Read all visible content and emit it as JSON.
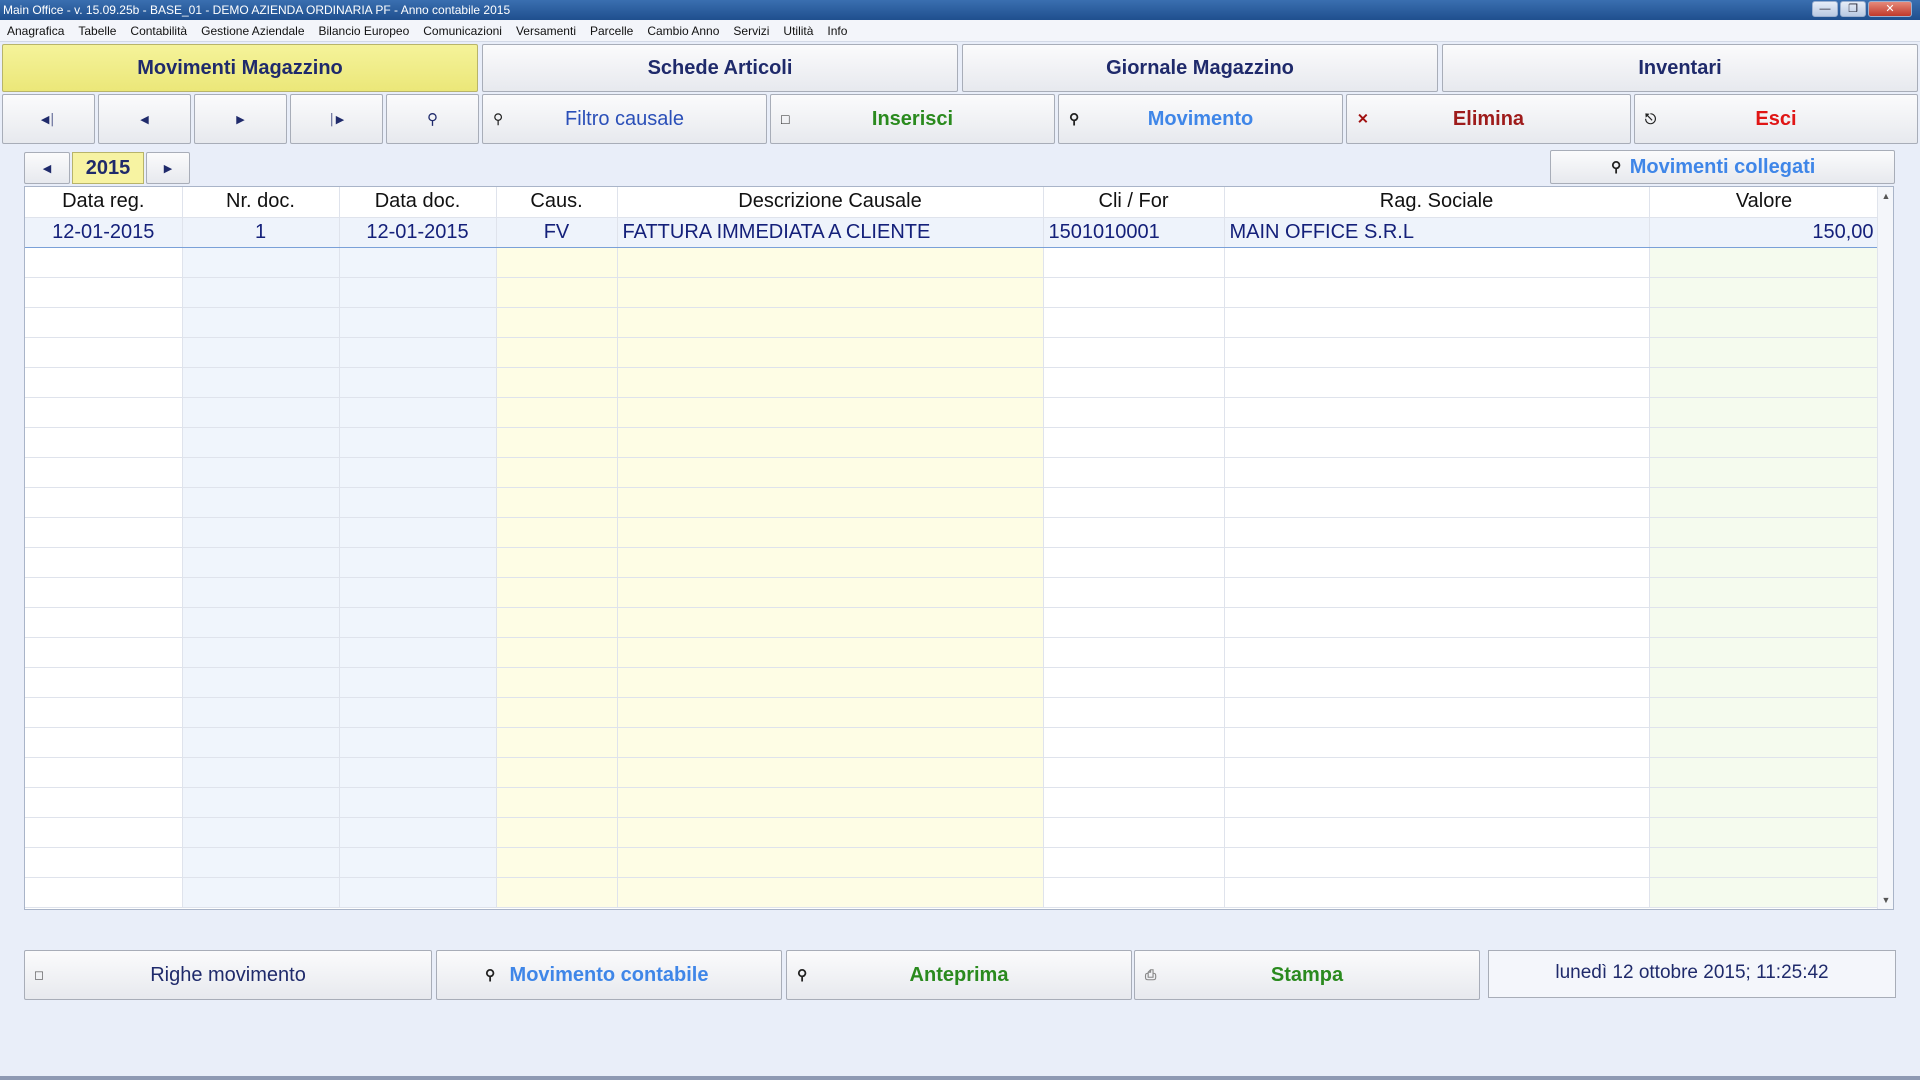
{
  "window": {
    "title": "Main Office - v. 15.09.25b - BASE_01 - DEMO AZIENDA ORDINARIA PF - Anno contabile 2015"
  },
  "menu": [
    "Anagrafica",
    "Tabelle",
    "Contabilità",
    "Gestione Aziendale",
    "Bilancio Europeo",
    "Comunicazioni",
    "Versamenti",
    "Parcelle",
    "Cambio Anno",
    "Servizi",
    "Utilità",
    "Info"
  ],
  "tabs": {
    "movimenti": "Movimenti Magazzino",
    "schede": "Schede Articoli",
    "giornale": "Giornale Magazzino",
    "inventari": "Inventari"
  },
  "toolbar": {
    "filtro": "Filtro causale",
    "inserisci": "Inserisci",
    "movimento": "Movimento",
    "elimina": "Elimina",
    "esci": "Esci"
  },
  "year": "2015",
  "collegati": "Movimenti collegati",
  "table": {
    "headers": [
      "Data reg.",
      "Nr. doc.",
      "Data doc.",
      "Caus.",
      "Descrizione Causale",
      "Cli / For",
      "Rag. Sociale",
      "Valore"
    ],
    "rows": [
      [
        "12-01-2015",
        "1",
        "12-01-2015",
        "FV",
        "FATTURA IMMEDIATA A CLIENTE",
        "1501010001",
        "MAIN OFFICE S.R.L",
        "150,00"
      ]
    ]
  },
  "bottom": {
    "righe": "Righe movimento",
    "contabile": "Movimento contabile",
    "anteprima": "Anteprima",
    "stampa": "Stampa",
    "datetime": "lunedì 12 ottobre 2015; 11:25:42"
  },
  "colors": {
    "active_tab": "#f5f39a",
    "inserisci": "#2a8a1e",
    "elimina": "#9e1b1b",
    "esci": "#e01515",
    "movimento": "#3f86e8"
  }
}
